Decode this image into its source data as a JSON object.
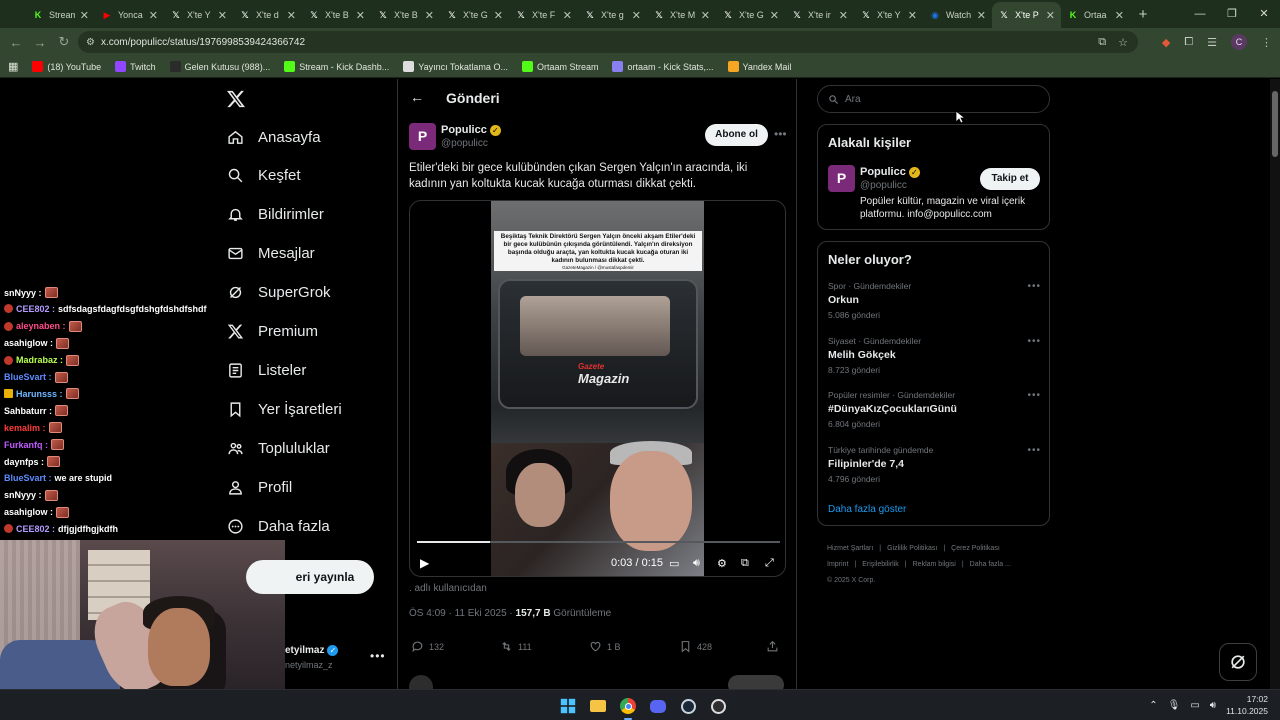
{
  "browser": {
    "tabs": [
      {
        "title": "Stream",
        "icon": "kick-icon",
        "color": "#53fc18"
      },
      {
        "title": "Yonca",
        "icon": "youtube-icon",
        "color": "#ff0000"
      },
      {
        "title": "X'te Y",
        "icon": "x-icon",
        "color": "#ffffff"
      },
      {
        "title": "X'te d",
        "icon": "x-icon",
        "color": "#ffffff"
      },
      {
        "title": "X'te B",
        "icon": "x-icon",
        "color": "#ffffff"
      },
      {
        "title": "X'te B",
        "icon": "x-icon",
        "color": "#ffffff"
      },
      {
        "title": "X'te G",
        "icon": "x-icon",
        "color": "#ffffff"
      },
      {
        "title": "X'te F",
        "icon": "x-icon",
        "color": "#ffffff"
      },
      {
        "title": "X'te g",
        "icon": "x-icon",
        "color": "#ffffff"
      },
      {
        "title": "X'te M",
        "icon": "x-icon",
        "color": "#ffffff"
      },
      {
        "title": "X'te G",
        "icon": "x-icon",
        "color": "#ffffff"
      },
      {
        "title": "X'te ir",
        "icon": "x-icon",
        "color": "#ffffff"
      },
      {
        "title": "X'te Y",
        "icon": "x-icon",
        "color": "#ffffff"
      },
      {
        "title": "Watch",
        "icon": "globe-icon",
        "color": "#1a73e8"
      },
      {
        "title": "X'te P",
        "icon": "x-icon",
        "color": "#ffffff",
        "active": true
      },
      {
        "title": "Ortaa",
        "icon": "kick-icon",
        "color": "#53fc18"
      }
    ],
    "url": "x.com/populicc/status/1976998539424366742",
    "profile_initial": "C",
    "bookmarks": [
      {
        "label": "(18) YouTube",
        "color": "#ff0000"
      },
      {
        "label": "Twitch",
        "color": "#9146ff"
      },
      {
        "label": "Gelen Kutusu (988)...",
        "color": "#2b2b2b"
      },
      {
        "label": "Stream - Kick Dashb...",
        "color": "#53fc18"
      },
      {
        "label": "Yayıncı Tokatlama O...",
        "color": "#dddddd"
      },
      {
        "label": "Ortaam Stream",
        "color": "#53fc18"
      },
      {
        "label": "ortaam - Kick Stats,...",
        "color": "#8a7ff0"
      },
      {
        "label": "Yandex Mail",
        "color": "#f6a623"
      }
    ]
  },
  "chat": {
    "lines": [
      {
        "user": "snNyyy :",
        "color": "#ffffff",
        "msg": "",
        "badge": ""
      },
      {
        "user": "CEE802 :",
        "color": "#b49cff",
        "msg": "sdfsdagsfdagfdsgfdshgfdshdfshdf",
        "badge": "red"
      },
      {
        "user": "aleynaben :",
        "color": "#ff4e8a",
        "msg": "",
        "badge": "red"
      },
      {
        "user": "asahiglow :",
        "color": "#ffffff",
        "msg": "",
        "badge": ""
      },
      {
        "user": "Madrabaz :",
        "color": "#b7ff52",
        "msg": "",
        "badge": "red"
      },
      {
        "user": "BlueSvart :",
        "color": "#5b8cff",
        "msg": "",
        "badge": ""
      },
      {
        "user": "Harunsss :",
        "color": "#6fb7ff",
        "msg": "",
        "badge": "yellow"
      },
      {
        "user": "Sahbaturr :",
        "color": "#ffffff",
        "msg": "",
        "badge": ""
      },
      {
        "user": "kemalim :",
        "color": "#ff3b3b",
        "msg": "",
        "badge": ""
      },
      {
        "user": "Furkanfq :",
        "color": "#c05bff",
        "msg": "",
        "badge": ""
      },
      {
        "user": "daynfps :",
        "color": "#ffffff",
        "msg": "",
        "badge": ""
      },
      {
        "user": "BlueSvart :",
        "color": "#5b8cff",
        "msg": "we are stupid",
        "badge": ""
      },
      {
        "user": "snNyyy :",
        "color": "#ffffff",
        "msg": "",
        "badge": ""
      },
      {
        "user": "asahiglow :",
        "color": "#ffffff",
        "msg": "",
        "badge": ""
      },
      {
        "user": "CEE802 :",
        "color": "#b49cff",
        "msg": "dfjgjdfhgjkdfh",
        "badge": "red"
      }
    ]
  },
  "nav": {
    "items": [
      {
        "label": "Anasayfa",
        "icon": "home-icon"
      },
      {
        "label": "Keşfet",
        "icon": "search-icon"
      },
      {
        "label": "Bildirimler",
        "icon": "bell-icon"
      },
      {
        "label": "Mesajlar",
        "icon": "mail-icon"
      },
      {
        "label": "SuperGrok",
        "icon": "grok-icon"
      },
      {
        "label": "Premium",
        "icon": "x-icon"
      },
      {
        "label": "Listeler",
        "icon": "list-icon"
      },
      {
        "label": "Yer İşaretleri",
        "icon": "bookmark-icon"
      },
      {
        "label": "Topluluklar",
        "icon": "community-icon"
      },
      {
        "label": "Profil",
        "icon": "profile-icon"
      },
      {
        "label": "Daha fazla",
        "icon": "more-icon"
      }
    ],
    "post_label": "eri yayınla",
    "account_name": "etyilmaz",
    "account_handle": "netyilmaz_z"
  },
  "post": {
    "header": "Gönderi",
    "avatar_letter": "P",
    "author_name": "Populicc",
    "author_handle": "@populicc",
    "subscribe_label": "Abone ol",
    "text": "Etiler'deki bir gece kulübünden çıkan Sergen Yalçın'ın aracında, iki kadının yan koltukta kucak kucağa oturması dikkat çekti.",
    "video": {
      "caption": "Beşiktaş Teknik Direktörü Sergen Yalçın önceki akşam Etiler'deki bir gece kulübünün çıkışında görüntülendi. Yalçın'ın direksiyon başında olduğu araçta, yan koltukta kucak kucağa oturan iki kadının bulunması dikkat çekti.",
      "caption_source": "GazeteMagazin / @mustafaspdemir",
      "logo_top": "Gazete",
      "logo_bottom": "Magazin",
      "time": "0:03 / 0:15",
      "progress": 0.2
    },
    "attribution": ". adlı kullanıcıdan",
    "meta_time": "ÖS 4:09 · 11 Eki 2025 · ",
    "meta_views": "157,7 B",
    "meta_views_label": " Görüntüleme",
    "stats": {
      "replies": "132",
      "reposts": "111",
      "likes": "1 B",
      "bookmarks": "428"
    }
  },
  "sidebar": {
    "search_placeholder": "Ara",
    "related": {
      "title": "Alakalı kişiler",
      "name": "Populicc",
      "handle": "@populicc",
      "follow_label": "Takip et",
      "bio": "Popüler kültür, magazin ve viral içerik platformu. info@populicc.com"
    },
    "trends": {
      "title": "Neler oluyor?",
      "items": [
        {
          "context": "Spor · Gündemdekiler",
          "name": "Orkun",
          "posts": "5.086 gönderi"
        },
        {
          "context": "Siyaset · Gündemdekiler",
          "name": "Melih Gökçek",
          "posts": "8.723 gönderi"
        },
        {
          "context": "Popüler resimler · Gündemdekiler",
          "name": "#DünyaKızÇocuklarıGünü",
          "posts": "6.804 gönderi"
        },
        {
          "context": "Türkiye tarihinde gündemde",
          "name": "Filipinler'de 7,4",
          "posts": "4.796 gönderi"
        }
      ],
      "show_more": "Daha fazla göster"
    },
    "footer": [
      "Hizmet Şartları",
      "Gizlilik Politikası",
      "Çerez Politikası",
      "Imprint",
      "Erişilebilirlik",
      "Reklam bilgisi",
      "Daha fazla ...",
      "© 2025 X Corp."
    ]
  },
  "taskbar": {
    "time": "17:02",
    "date": "11.10.2025"
  }
}
